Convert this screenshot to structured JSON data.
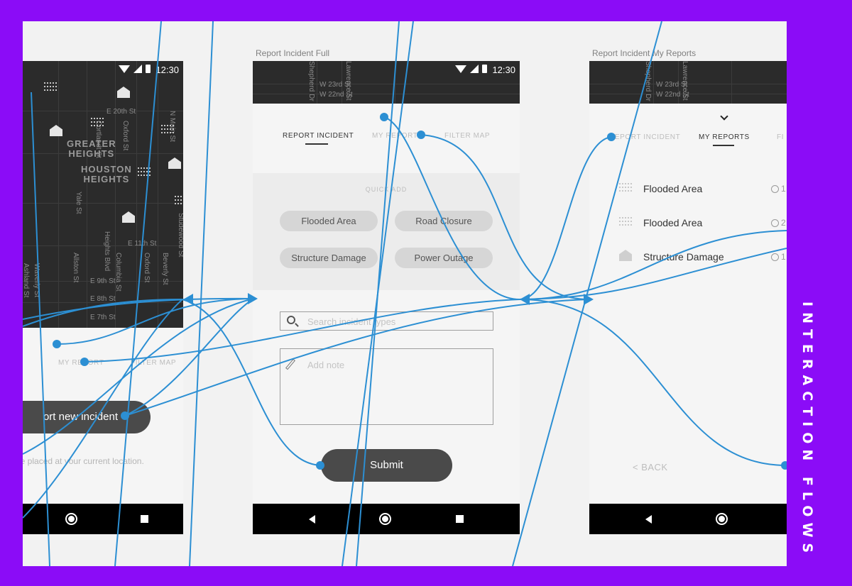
{
  "side_label": "INTERACTION FLOWS",
  "colors": {
    "frame": "#8b0cf7",
    "flow": "#2c8fd3",
    "dark_button": "#4a4a4a"
  },
  "screen_left": {
    "status_time": "12:30",
    "map_area_labels": [
      "GREATER\nHEIGHTS",
      "HOUSTON\nHEIGHTS"
    ],
    "map_street_labels": [
      "E 20th St",
      "E 11th St",
      "E 9th St",
      "E 8th St",
      "E 7th St",
      "Cortlandt St",
      "Oxford St",
      "N Main St",
      "Yale St",
      "Heights Blvd",
      "Allston St",
      "Columbia St",
      "Oxford St",
      "Beverly St",
      "Studewood St",
      "Ashland St",
      "Waverly St"
    ],
    "tab_my_reports": "MY REPORT",
    "tab_filter_map": "FILTER MAP",
    "report_button": "ort new incident",
    "helper_text": "be placed at your current location."
  },
  "screen_middle": {
    "title": "Report Incident Full",
    "status_time": "12:30",
    "map_street_labels": [
      "W 23rd St",
      "W 22nd St",
      "Shepherd Dr",
      "Lawrence St"
    ],
    "tabs": [
      {
        "label": "REPORT INCIDENT",
        "active": true
      },
      {
        "label": "MY REPORTS",
        "active": false
      },
      {
        "label": "FILTER MAP",
        "active": false
      }
    ],
    "quick_add_title": "QUICK ADD",
    "chips": [
      "Flooded Area",
      "Road Closure",
      "Structure Damage",
      "Power Outage"
    ],
    "search_placeholder": "Search incident types",
    "note_placeholder": "Add note",
    "submit_label": "Submit"
  },
  "screen_right": {
    "title": "Report Incident My Reports",
    "map_street_labels": [
      "W 23rd St",
      "W 22nd St",
      "Shepherd Dr",
      "Lawrence St"
    ],
    "tabs": [
      {
        "label": "REPORT INCIDENT",
        "active": false
      },
      {
        "label": "MY REPORTS",
        "active": true
      },
      {
        "label": "FI",
        "active": false
      }
    ],
    "reports": [
      {
        "label": "Flooded Area",
        "icon": "flood-icon",
        "time": "1"
      },
      {
        "label": "Flooded Area",
        "icon": "flood-icon",
        "time": "2"
      },
      {
        "label": "Structure Damage",
        "icon": "structure-damage-icon",
        "time": "1"
      }
    ],
    "back_label": "< BACK"
  }
}
